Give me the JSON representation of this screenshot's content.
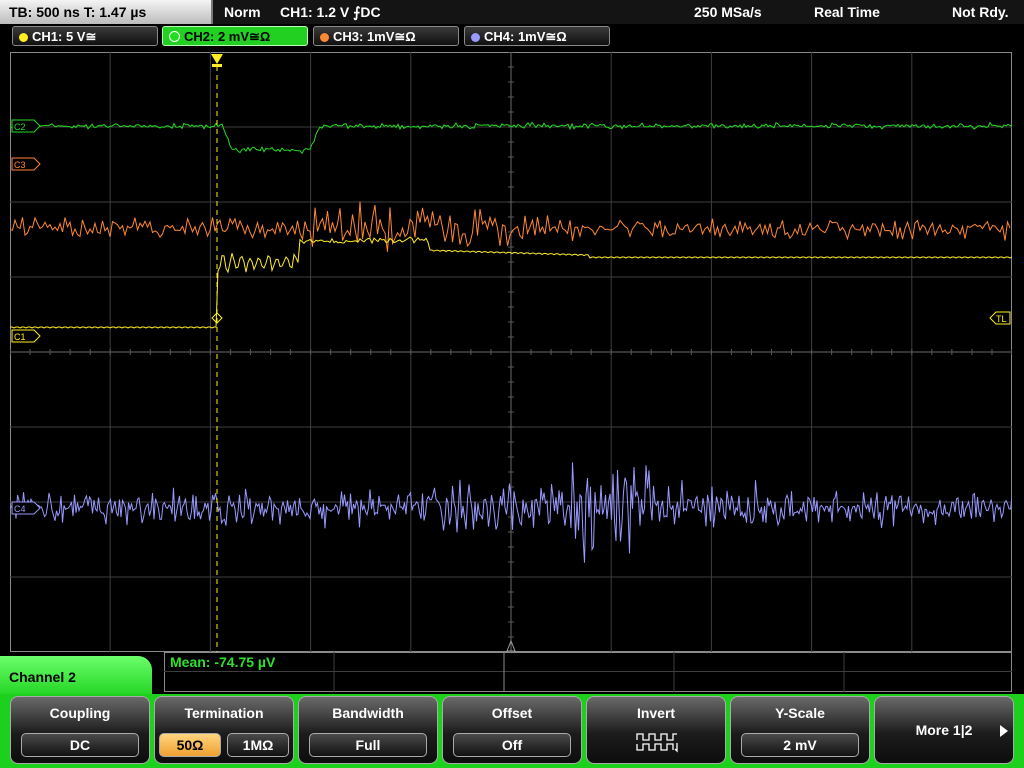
{
  "topbar": {
    "timebase": "TB: 500 ns   T: 1.47 µs",
    "mode": "Norm",
    "trigger": "CH1: 1.2 V ⨍DC",
    "samplerate": "250 MSa/s",
    "acq": "Real Time",
    "state": "Not Rdy."
  },
  "channels": [
    {
      "label": "CH1: 5 V≅",
      "color": "#ffee22"
    },
    {
      "label": "CH2: 2 mV≅Ω",
      "color": "#22dd22"
    },
    {
      "label": "CH3: 1mV≅Ω",
      "color": "#ff8833"
    },
    {
      "label": "CH4: 1mV≅Ω",
      "color": "#9999ff"
    }
  ],
  "markers": {
    "c2": "C2",
    "c3": "C3",
    "c1": "C1",
    "tl": "TL",
    "c4": "C4"
  },
  "measurement": {
    "mean": "Mean: -74.75 µV"
  },
  "menu": {
    "title": "Channel 2",
    "coupling": {
      "label": "Coupling",
      "value": "DC"
    },
    "termination": {
      "label": "Termination",
      "opt1": "50Ω",
      "opt2": "1MΩ"
    },
    "bandwidth": {
      "label": "Bandwidth",
      "value": "Full"
    },
    "offset": {
      "label": "Offset",
      "value": "Off"
    },
    "invert": {
      "label": "Invert"
    },
    "yscale": {
      "label": "Y-Scale",
      "value": "2 mV"
    },
    "more": {
      "label": "More 1|2"
    }
  }
}
